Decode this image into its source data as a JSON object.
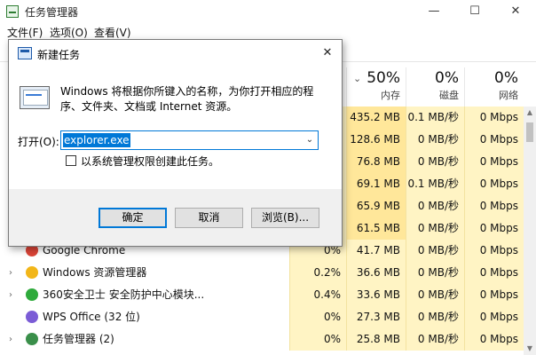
{
  "window": {
    "title": "任务管理器",
    "minimize": "—",
    "maximize": "☐",
    "close": "✕"
  },
  "menu": [
    "文件(F)",
    "选项(O)",
    "查看(V)"
  ],
  "columns": {
    "memory": {
      "pct": "50%",
      "label": "内存"
    },
    "disk": {
      "pct": "0%",
      "label": "磁盘"
    },
    "network": {
      "pct": "0%",
      "label": "网络"
    }
  },
  "rows": [
    {
      "name": "",
      "cpu": "",
      "memory": "435.2 MB",
      "disk": "0.1 MB/秒",
      "network": "0 Mbps",
      "expandable": false,
      "icon": "",
      "color": ""
    },
    {
      "name": "",
      "cpu": "",
      "memory": "128.6 MB",
      "disk": "0 MB/秒",
      "network": "0 Mbps",
      "expandable": false,
      "icon": "",
      "color": ""
    },
    {
      "name": "",
      "cpu": "",
      "memory": "76.8 MB",
      "disk": "0 MB/秒",
      "network": "0 Mbps",
      "expandable": false,
      "icon": "",
      "color": ""
    },
    {
      "name": "",
      "cpu": "",
      "memory": "69.1 MB",
      "disk": "0.1 MB/秒",
      "network": "0 Mbps",
      "expandable": false,
      "icon": "",
      "color": ""
    },
    {
      "name": "",
      "cpu": "",
      "memory": "65.9 MB",
      "disk": "0 MB/秒",
      "network": "0 Mbps",
      "expandable": false,
      "icon": "",
      "color": ""
    },
    {
      "name": "",
      "cpu": "",
      "memory": "61.5 MB",
      "disk": "0 MB/秒",
      "network": "0 Mbps",
      "expandable": false,
      "icon": "",
      "color": ""
    },
    {
      "name": "Google Chrome",
      "cpu": "0%",
      "memory": "41.7 MB",
      "disk": "0 MB/秒",
      "network": "0 Mbps",
      "expandable": false,
      "icon": "chrome-icon",
      "color": "#db4437"
    },
    {
      "name": "Windows 资源管理器",
      "cpu": "0.2%",
      "memory": "36.6 MB",
      "disk": "0 MB/秒",
      "network": "0 Mbps",
      "expandable": true,
      "icon": "folder-icon",
      "color": "#f2b619"
    },
    {
      "name": "360安全卫士 安全防护中心模块...",
      "cpu": "0.4%",
      "memory": "33.6 MB",
      "disk": "0 MB/秒",
      "network": "0 Mbps",
      "expandable": true,
      "icon": "shield-plus-icon",
      "color": "#2eaa3b"
    },
    {
      "name": "WPS Office (32 位)",
      "cpu": "0%",
      "memory": "27.3 MB",
      "disk": "0 MB/秒",
      "network": "0 Mbps",
      "expandable": false,
      "icon": "wps-icon",
      "color": "#7b5cd6"
    },
    {
      "name": "任务管理器 (2)",
      "cpu": "0%",
      "memory": "25.8 MB",
      "disk": "0 MB/秒",
      "network": "0 Mbps",
      "expandable": true,
      "icon": "task-manager-icon",
      "color": "#3a8f4a"
    }
  ],
  "dialog": {
    "title": "新建任务",
    "close": "✕",
    "description": "Windows 将根据你所键入的名称，为你打开相应的程序、文件夹、文档或 Internet 资源。",
    "open_label": "打开(O):",
    "command": "explorer.exe",
    "admin_label": "以系统管理权限创建此任务。",
    "admin_checked": false,
    "ok": "确定",
    "cancel": "取消",
    "browse": "浏览(B)..."
  }
}
